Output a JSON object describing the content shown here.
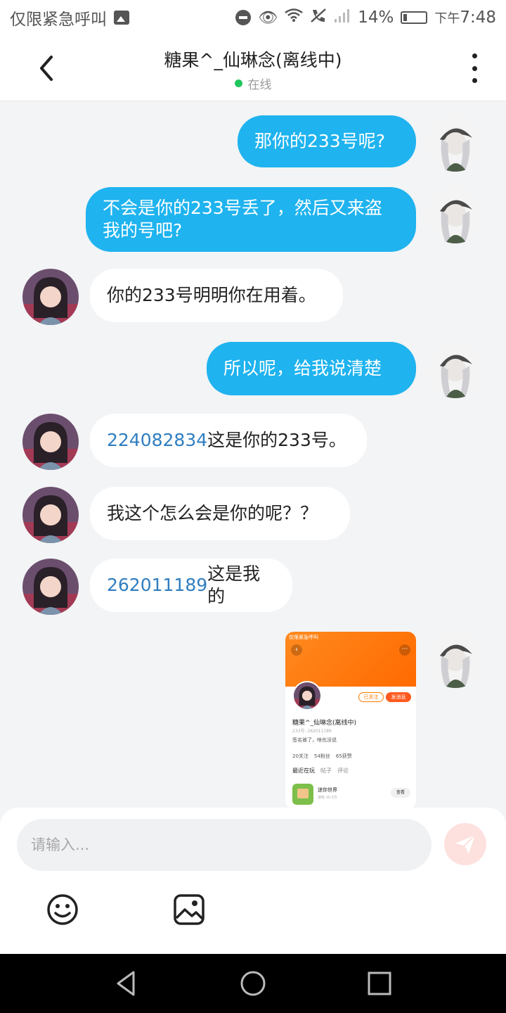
{
  "status_bar": {
    "left_text": "仅限紧急呼叫",
    "battery_percent": "14%",
    "time_prefix": "下午",
    "time": "7:48",
    "icons": [
      "image-icon",
      "do-not-disturb-icon",
      "eye-icon",
      "wifi-icon",
      "call-icon",
      "signal-icon",
      "battery-charging-icon"
    ]
  },
  "header": {
    "title": "糖果^_仙琳念(离线中)",
    "status": "在线",
    "status_color": "#22c55e"
  },
  "messages": [
    {
      "direction": "out",
      "text": "那你的233号呢?"
    },
    {
      "direction": "out",
      "line1": "不会是你的233号丢了，然后又来盗",
      "line2": "我的号吧?"
    },
    {
      "direction": "in",
      "text": "你的233号明明你在用着。"
    },
    {
      "direction": "out",
      "text": "所以呢，给我说清楚"
    },
    {
      "direction": "in",
      "number": "224082834",
      "text": " 这是你的233号。"
    },
    {
      "direction": "in",
      "text": "我这个怎么会是你的呢？？"
    },
    {
      "direction": "in",
      "number": "262011189",
      "text": "这是我的"
    },
    {
      "direction": "out",
      "type": "image",
      "image": {
        "status": "仅限紧急呼叫",
        "follow_btn": "已关注",
        "message_btn": "发消息",
        "name": "糖果^_仙琳念(离线中)",
        "id_line": "233号: 262011189",
        "signature": "签名被了，啥也没说",
        "stats": [
          {
            "num": "20",
            "label": "关注"
          },
          {
            "num": "54",
            "label": "粉丝"
          },
          {
            "num": "65",
            "label": "获赞"
          }
        ],
        "tabs": [
          "最近在玩",
          "帖子",
          "评论"
        ],
        "game_name": "迷你世界",
        "game_sub": "游戏 10.3万",
        "view_btn": "查看"
      }
    }
  ],
  "input": {
    "placeholder": "请输入..."
  },
  "colors": {
    "outgoing_bubble": "#1fb3ef",
    "incoming_bubble": "#ffffff",
    "number_link": "#2f7ec0",
    "send_button": "#fde1df"
  }
}
